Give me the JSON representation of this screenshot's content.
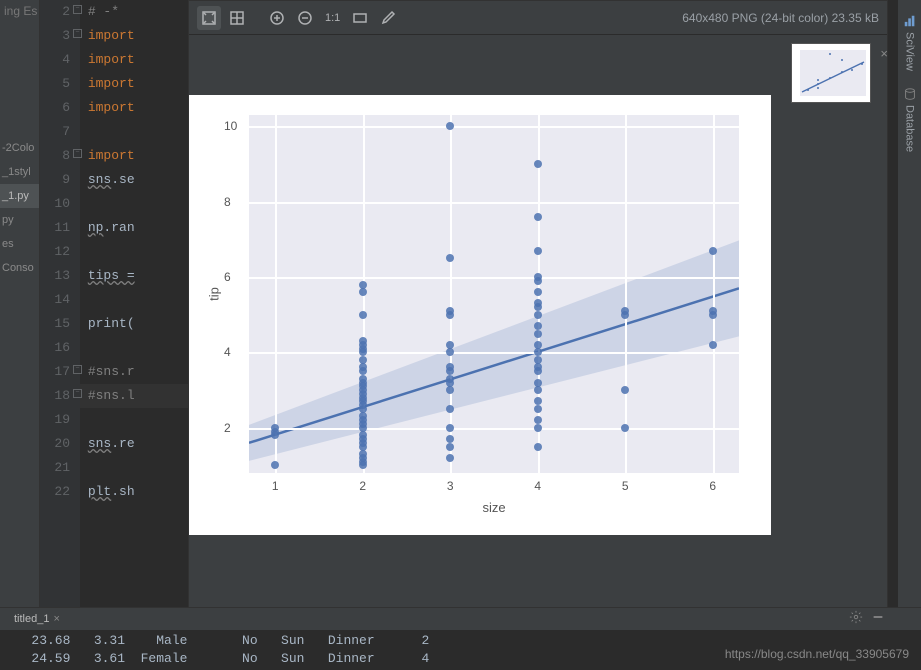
{
  "breadcrumb": "ing  Es",
  "left_tabs": {
    "t0": "-2Colo",
    "t1": "_1styl",
    "t2": "_1.py",
    "t3": "py",
    "t4": "es",
    "t5": "Conso"
  },
  "gutter_lines": [
    "2",
    "3",
    "4",
    "5",
    "6",
    "7",
    "8",
    "9",
    "10",
    "11",
    "12",
    "13",
    "14",
    "15",
    "16",
    "17",
    "18",
    "19",
    "20",
    "21",
    "22"
  ],
  "code": {
    "l2": "# -*",
    "l3": "import",
    "l4": "import",
    "l5": "import",
    "l6": "import",
    "l7": "",
    "l8": "import",
    "l9": "sns.se",
    "l10": "",
    "l11": "np.ran",
    "l12": "",
    "l13": "tips =",
    "l14": "",
    "l15": "print(",
    "l16": "",
    "l17": "#sns.r",
    "l18": "#sns.l",
    "l19": "",
    "l20": "sns.re",
    "l21": "",
    "l22": "plt.sh"
  },
  "sciview": {
    "ratio_label": "1:1",
    "info": "640x480 PNG (24-bit color) 23.35 kB"
  },
  "chart_data": {
    "type": "scatter",
    "xlabel": "size",
    "ylabel": "tip",
    "x_ticks": [
      1,
      2,
      3,
      4,
      5,
      6
    ],
    "y_ticks": [
      2,
      4,
      6,
      8,
      10
    ],
    "xlim": [
      0.7,
      6.3
    ],
    "ylim": [
      0.8,
      10.3
    ],
    "points": [
      {
        "x": 1,
        "y": 1.0
      },
      {
        "x": 1,
        "y": 1.8
      },
      {
        "x": 1,
        "y": 1.9
      },
      {
        "x": 1,
        "y": 2.0
      },
      {
        "x": 2,
        "y": 1.0
      },
      {
        "x": 2,
        "y": 1.1
      },
      {
        "x": 2,
        "y": 1.2
      },
      {
        "x": 2,
        "y": 1.3
      },
      {
        "x": 2,
        "y": 1.5
      },
      {
        "x": 2,
        "y": 1.6
      },
      {
        "x": 2,
        "y": 1.7
      },
      {
        "x": 2,
        "y": 1.8
      },
      {
        "x": 2,
        "y": 2.0
      },
      {
        "x": 2,
        "y": 2.1
      },
      {
        "x": 2,
        "y": 2.2
      },
      {
        "x": 2,
        "y": 2.3
      },
      {
        "x": 2,
        "y": 2.5
      },
      {
        "x": 2,
        "y": 2.6
      },
      {
        "x": 2,
        "y": 2.7
      },
      {
        "x": 2,
        "y": 2.8
      },
      {
        "x": 2,
        "y": 2.9
      },
      {
        "x": 2,
        "y": 3.0
      },
      {
        "x": 2,
        "y": 3.1
      },
      {
        "x": 2,
        "y": 3.2
      },
      {
        "x": 2,
        "y": 3.3
      },
      {
        "x": 2,
        "y": 3.5
      },
      {
        "x": 2,
        "y": 3.6
      },
      {
        "x": 2,
        "y": 3.8
      },
      {
        "x": 2,
        "y": 4.0
      },
      {
        "x": 2,
        "y": 4.1
      },
      {
        "x": 2,
        "y": 4.2
      },
      {
        "x": 2,
        "y": 4.3
      },
      {
        "x": 2,
        "y": 5.0
      },
      {
        "x": 2,
        "y": 5.6
      },
      {
        "x": 2,
        "y": 5.8
      },
      {
        "x": 3,
        "y": 1.2
      },
      {
        "x": 3,
        "y": 1.5
      },
      {
        "x": 3,
        "y": 1.7
      },
      {
        "x": 3,
        "y": 2.0
      },
      {
        "x": 3,
        "y": 2.5
      },
      {
        "x": 3,
        "y": 3.0
      },
      {
        "x": 3,
        "y": 3.2
      },
      {
        "x": 3,
        "y": 3.3
      },
      {
        "x": 3,
        "y": 3.5
      },
      {
        "x": 3,
        "y": 3.6
      },
      {
        "x": 3,
        "y": 4.0
      },
      {
        "x": 3,
        "y": 4.2
      },
      {
        "x": 3,
        "y": 5.0
      },
      {
        "x": 3,
        "y": 5.1
      },
      {
        "x": 3,
        "y": 6.5
      },
      {
        "x": 3,
        "y": 10.0
      },
      {
        "x": 4,
        "y": 1.5
      },
      {
        "x": 4,
        "y": 2.0
      },
      {
        "x": 4,
        "y": 2.2
      },
      {
        "x": 4,
        "y": 2.5
      },
      {
        "x": 4,
        "y": 2.7
      },
      {
        "x": 4,
        "y": 3.0
      },
      {
        "x": 4,
        "y": 3.2
      },
      {
        "x": 4,
        "y": 3.5
      },
      {
        "x": 4,
        "y": 3.6
      },
      {
        "x": 4,
        "y": 3.8
      },
      {
        "x": 4,
        "y": 4.0
      },
      {
        "x": 4,
        "y": 4.2
      },
      {
        "x": 4,
        "y": 4.5
      },
      {
        "x": 4,
        "y": 4.7
      },
      {
        "x": 4,
        "y": 5.0
      },
      {
        "x": 4,
        "y": 5.2
      },
      {
        "x": 4,
        "y": 5.3
      },
      {
        "x": 4,
        "y": 5.6
      },
      {
        "x": 4,
        "y": 5.9
      },
      {
        "x": 4,
        "y": 6.0
      },
      {
        "x": 4,
        "y": 6.7
      },
      {
        "x": 4,
        "y": 7.6
      },
      {
        "x": 4,
        "y": 9.0
      },
      {
        "x": 5,
        "y": 2.0
      },
      {
        "x": 5,
        "y": 3.0
      },
      {
        "x": 5,
        "y": 5.0
      },
      {
        "x": 5,
        "y": 5.1
      },
      {
        "x": 6,
        "y": 4.2
      },
      {
        "x": 6,
        "y": 5.0
      },
      {
        "x": 6,
        "y": 5.1
      },
      {
        "x": 6,
        "y": 6.7
      }
    ],
    "regression": {
      "x0": 0.7,
      "y0": 1.6,
      "x1": 6.3,
      "y1": 5.7
    }
  },
  "right_rail": {
    "sciview": "SciView",
    "database": "Database"
  },
  "bottom": {
    "tab_label": "titled_1",
    "console_rows": [
      "   23.68   3.31    Male       No   Sun   Dinner      2",
      "   24.59   3.61  Female       No   Sun   Dinner      4"
    ]
  },
  "watermark": "https://blog.csdn.net/qq_33905679"
}
